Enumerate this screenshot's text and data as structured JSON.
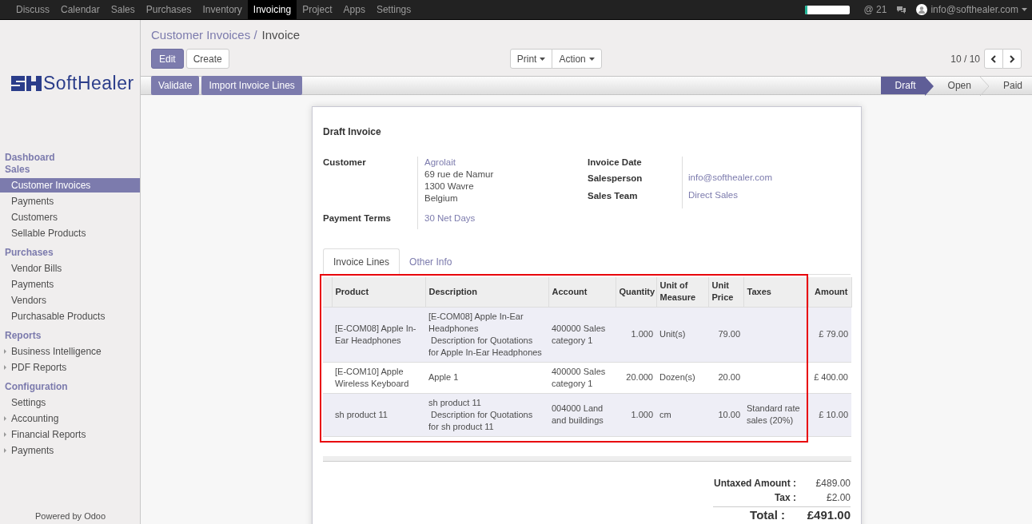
{
  "top_menu": [
    {
      "label": "Discuss",
      "selected": false
    },
    {
      "label": "Calendar",
      "selected": false
    },
    {
      "label": "Sales",
      "selected": false
    },
    {
      "label": "Purchases",
      "selected": false
    },
    {
      "label": "Inventory",
      "selected": false
    },
    {
      "label": "Invoicing",
      "selected": true
    },
    {
      "label": "Project",
      "selected": false
    },
    {
      "label": "Apps",
      "selected": false
    },
    {
      "label": "Settings",
      "selected": false
    }
  ],
  "systray": {
    "progress": {
      "level": 0.06
    },
    "mentions": "@ 21",
    "user": "info@softhealer.com"
  },
  "logo": {
    "text": "SoftHealer"
  },
  "sidebar": [
    {
      "heading": "Dashboard"
    },
    {
      "heading": "Sales",
      "items": [
        {
          "label": "Customer Invoices",
          "selected": true,
          "kind": "leaf"
        },
        {
          "label": "Payments",
          "selected": false,
          "kind": "leaf"
        },
        {
          "label": "Customers",
          "selected": false,
          "kind": "leaf"
        },
        {
          "label": "Sellable Products",
          "selected": false,
          "kind": "leaf"
        }
      ]
    },
    {
      "heading": "Purchases",
      "items": [
        {
          "label": "Vendor Bills",
          "selected": false,
          "kind": "leaf"
        },
        {
          "label": "Payments",
          "selected": false,
          "kind": "leaf"
        },
        {
          "label": "Vendors",
          "selected": false,
          "kind": "leaf"
        },
        {
          "label": "Purchasable Products",
          "selected": false,
          "kind": "leaf"
        }
      ]
    },
    {
      "heading": "Reports",
      "items": [
        {
          "label": "Business Intelligence",
          "selected": false,
          "kind": "folder"
        },
        {
          "label": "PDF Reports",
          "selected": false,
          "kind": "folder"
        }
      ]
    },
    {
      "heading": "Configuration",
      "items": [
        {
          "label": "Settings",
          "selected": false,
          "kind": "leaf"
        },
        {
          "label": "Accounting",
          "selected": false,
          "kind": "folder"
        },
        {
          "label": "Financial Reports",
          "selected": false,
          "kind": "folder"
        },
        {
          "label": "Payments",
          "selected": false,
          "kind": "folder"
        }
      ]
    }
  ],
  "powered_by": "Powered by Odoo",
  "breadcrumb": {
    "parent": "Customer Invoices /",
    "current": "Invoice"
  },
  "buttons": {
    "edit": "Edit",
    "create": "Create",
    "print": "Print",
    "action": "Action",
    "pager": "10 / 10"
  },
  "header_buttons": [
    "Validate",
    "Import Invoice Lines"
  ],
  "stages": [
    {
      "label": "Draft",
      "selected": true
    },
    {
      "label": "Open",
      "selected": false
    },
    {
      "label": "Paid",
      "selected": false
    }
  ],
  "form": {
    "title": "Draft Invoice",
    "customer": {
      "label": "Customer",
      "name": "Agrolait",
      "address": [
        "69 rue de Namur",
        "1300 Wavre",
        "Belgium"
      ]
    },
    "payment_terms": {
      "label": "Payment Terms",
      "value": "30 Net Days"
    },
    "invoice_date": {
      "label": "Invoice Date"
    },
    "salesperson": {
      "label": "Salesperson",
      "value": "info@softhealer.com"
    },
    "sales_team": {
      "label": "Sales Team",
      "value": "Direct Sales"
    }
  },
  "tabs": [
    {
      "label": "Invoice Lines",
      "selected": true
    },
    {
      "label": "Other Info",
      "selected": false
    }
  ],
  "table": {
    "columns": [
      "Product",
      "Description",
      "Account",
      "Quantity",
      "Unit of Measure",
      "Unit Price",
      "Taxes",
      "Amount"
    ],
    "rows": [
      {
        "product": "[E-COM08] Apple In-Ear Headphones",
        "description": [
          "[E-COM08] Apple In-Ear Headphones",
          " Description for Quotations for Apple In-Ear Headphones"
        ],
        "account": "400000 Sales category 1",
        "quantity": "1.000",
        "uom": "Unit(s)",
        "unit_price": "79.00",
        "taxes": "",
        "amount": "£ 79.00"
      },
      {
        "product": "[E-COM10] Apple Wireless Keyboard",
        "description": [
          "Apple 1"
        ],
        "account": "400000 Sales category 1",
        "quantity": "20.000",
        "uom": "Dozen(s)",
        "unit_price": "20.00",
        "taxes": "",
        "amount": "£ 400.00"
      },
      {
        "product": "sh product 11",
        "description": [
          "sh product 11",
          " Description for Quotations  for sh product 11"
        ],
        "account": "004000 Land and buildings",
        "quantity": "1.000",
        "uom": "cm",
        "unit_price": "10.00",
        "taxes": "Standard rate sales (20%)",
        "amount": "£ 10.00"
      }
    ]
  },
  "totals": {
    "untaxed_label": "Untaxed Amount :",
    "untaxed": "£489.00",
    "tax_label": "Tax :",
    "tax": "£2.00",
    "total_label": "Total :",
    "total": "£491.00"
  }
}
